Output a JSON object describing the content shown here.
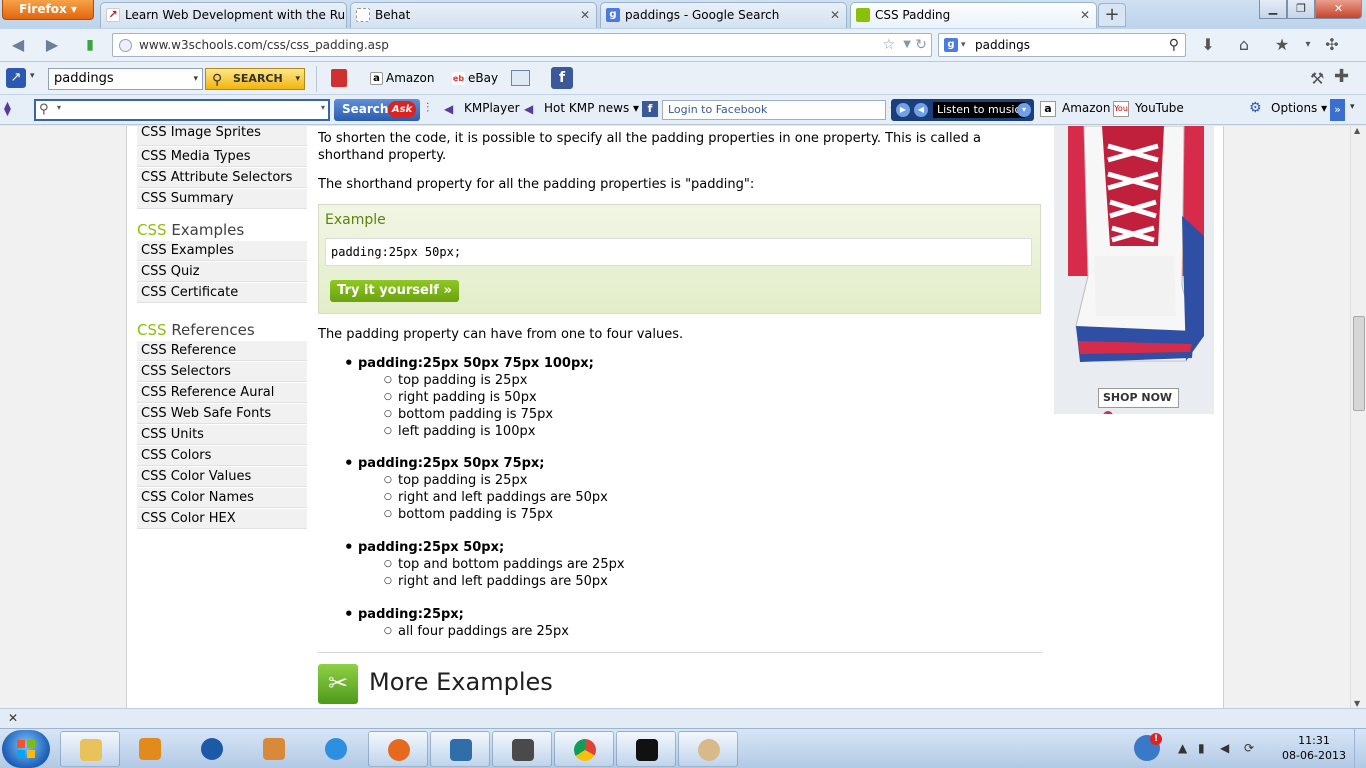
{
  "browser": {
    "menu_button": "Firefox",
    "tabs": [
      {
        "title": "Learn Web Development with the Ru...",
        "icon": "ruby-icon",
        "color": "#c61a1a"
      },
      {
        "title": "Behat",
        "icon": "blank-page-icon",
        "color": "#ffffff"
      },
      {
        "title": "paddings - Google Search",
        "icon": "google-icon",
        "color": "#4a7be0"
      },
      {
        "title": "CSS Padding",
        "icon": "w3schools-icon",
        "color": "#8ac007"
      }
    ],
    "url": "www.w3schools.com/css/css_padding.asp",
    "search_value": "paddings"
  },
  "toolbar1": {
    "search_value": "paddings",
    "search_button": "SEARCH",
    "links": [
      "Amazon",
      "eBay"
    ]
  },
  "toolbar2": {
    "ask_button": "Search",
    "ask_logo": "Ask",
    "links": [
      "KMPlayer",
      "Hot KMP news",
      "Amazon",
      "YouTube",
      "Options"
    ],
    "facebook_placeholder": "Login to Facebook",
    "music_label": "Listen to music"
  },
  "sidebar": {
    "group1": [
      "CSS Image Sprites",
      "CSS Media Types",
      "CSS Attribute Selectors",
      "CSS Summary"
    ],
    "examples_heading_a": "CSS",
    "examples_heading_b": "Examples",
    "group2": [
      "CSS Examples",
      "CSS Quiz",
      "CSS Certificate"
    ],
    "references_heading_a": "CSS",
    "references_heading_b": "References",
    "group3": [
      "CSS Reference",
      "CSS Selectors",
      "CSS Reference Aural",
      "CSS Web Safe Fonts",
      "CSS Units",
      "CSS Colors",
      "CSS Color Values",
      "CSS Color Names",
      "CSS Color HEX"
    ]
  },
  "main": {
    "intro": "To shorten the code, it is possible to specify all the padding properties in one property. This is called a shorthand property.",
    "shorthand": "The shorthand property for all the padding properties is \"padding\":",
    "example_title": "Example",
    "example_code": "padding:25px 50px;",
    "try_button": "Try it yourself »",
    "values_intro": "The padding property can have from one to four values.",
    "values": [
      {
        "head": "padding:25px 50px 75px 100px;",
        "items": [
          "top padding is 25px",
          "right padding is 50px",
          "bottom padding is 75px",
          "left padding is 100px"
        ]
      },
      {
        "head": "padding:25px 50px 75px;",
        "items": [
          "top padding is 25px",
          "right and left paddings are 50px",
          "bottom padding is 75px"
        ]
      },
      {
        "head": "padding:25px 50px;",
        "items": [
          "top and bottom paddings are 25px",
          "right and left paddings are 50px"
        ]
      },
      {
        "head": "padding:25px;",
        "items": [
          "all four paddings are 25px"
        ]
      }
    ],
    "more_examples": "More Examples"
  },
  "ad": {
    "shop_now": "SHOP NOW"
  },
  "taskbar": {
    "time": "11:31",
    "date": "08-06-2013"
  }
}
